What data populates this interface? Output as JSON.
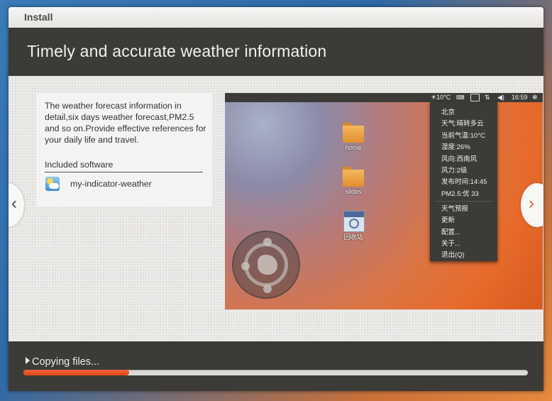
{
  "window": {
    "title": "Install"
  },
  "header": {
    "title": "Timely and accurate weather information"
  },
  "slide": {
    "description": "The weather forecast information in detail,six days weather forecast,PM2.5 and so on.Provide effective references for your daily life and travel.",
    "included_heading": "Included software",
    "software": [
      {
        "name": "my-indicator-weather",
        "icon": "weather-app-icon"
      }
    ]
  },
  "navigation": {
    "prev_glyph": "‹",
    "next_glyph": "›"
  },
  "screenshot": {
    "panel": {
      "weather": "☀10°C",
      "clock": "16:59",
      "volume": "◀)",
      "network": "⇅",
      "gear": "✻"
    },
    "desktop_icons": [
      {
        "label": "home",
        "icon": "folder-icon"
      },
      {
        "label": "slides",
        "icon": "folder-icon"
      },
      {
        "label": "回收站",
        "icon": "trash-icon"
      }
    ],
    "weather_menu": {
      "info": [
        "北京",
        "天气:晴转多云",
        "当前气温:10°C",
        "湿度:26%",
        "风向:西南风",
        "风力:2级",
        "发布时间:14:45",
        "PM2.5:优 33"
      ],
      "actions": [
        "天气预报",
        "更新",
        "配置...",
        "关于...",
        "退出(Q)"
      ]
    }
  },
  "footer": {
    "status": "Copying files...",
    "progress_percent": 21
  },
  "colors": {
    "accent": "#dd4814",
    "header_bg": "#3c3b37"
  }
}
